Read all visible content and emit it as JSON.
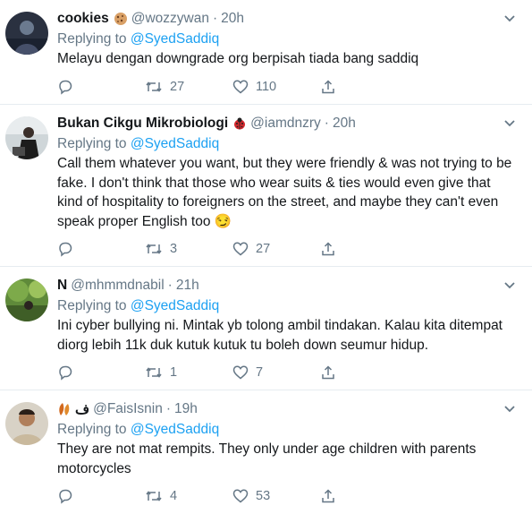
{
  "tweets": [
    {
      "name": "cookies",
      "name_emoji": "cookie-emoji",
      "handle": "@wozzywan",
      "dot": "·",
      "time": "20h",
      "replying_prefix": "Replying to",
      "replying_to": "@SyedSaddiq",
      "text": "Melayu dengan downgrade org berpisah tiada bang saddiq",
      "retweets": "27",
      "likes": "110"
    },
    {
      "name": "Bukan Cikgu Mikrobiologi",
      "name_emoji": "ladybug-emoji",
      "handle": "@iamdnzry",
      "dot": "·",
      "time": "20h",
      "replying_prefix": "Replying to",
      "replying_to": "@SyedSaddiq",
      "text": "Call them whatever you want, but they were friendly & was not trying to be fake. I don't think that those who wear suits & ties would even give that kind of hospitality to foreigners on the street, and maybe they can't even speak proper English too 😏",
      "retweets": "3",
      "likes": "27"
    },
    {
      "name": "N",
      "handle": "@mhmmdnabil",
      "dot": "·",
      "time": "21h",
      "replying_prefix": "Replying to",
      "replying_to": "@SyedSaddiq",
      "text": "Ini cyber bullying ni. Mintak yb tolong ambil tindakan. Kalau kita ditempat diorg lebih 11k duk kutuk kutuk tu boleh down seumur hidup.",
      "retweets": "1",
      "likes": "7"
    },
    {
      "name": "ف",
      "name_emoji": "leaves-emoji",
      "handle": "@FaisIsnin",
      "dot": "·",
      "time": "19h",
      "replying_prefix": "Replying to",
      "replying_to": "@SyedSaddiq",
      "text": "They are not mat rempits. They only under age children with parents motorcycles",
      "retweets": "4",
      "likes": "53"
    }
  ],
  "colors": {
    "link": "#1da1f2",
    "muted": "#657786",
    "text": "#14171a",
    "border": "#e6ecf0"
  }
}
